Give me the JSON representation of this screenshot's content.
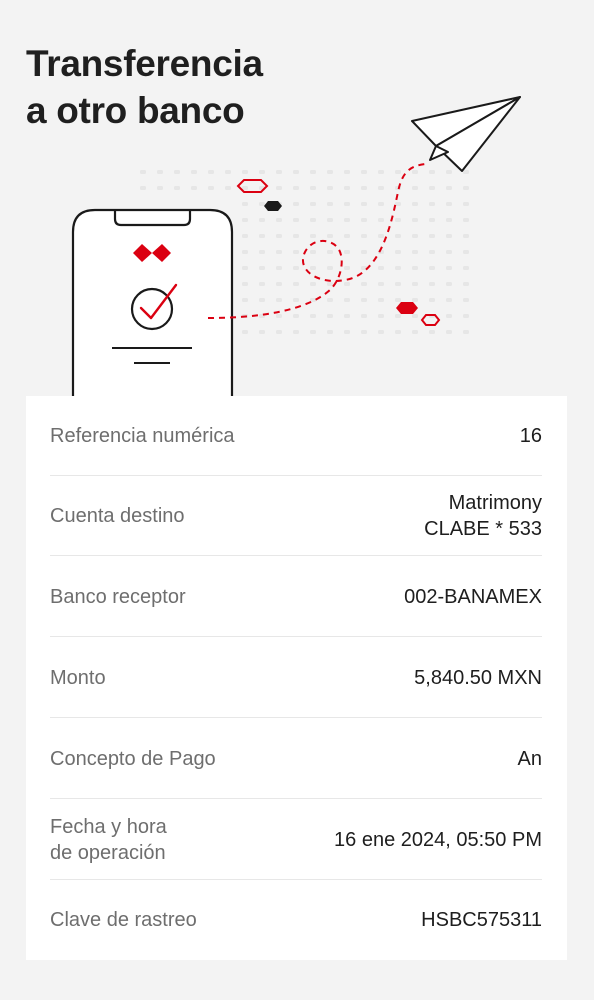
{
  "header": {
    "title_line1": "Transferencia",
    "title_line2": "a otro banco"
  },
  "illustration": {
    "description_icons": [
      "phone-icon",
      "hsbc-logo-icon",
      "check-circle-icon",
      "paper-plane-icon"
    ],
    "accent_color": "#db0011"
  },
  "details": {
    "rows": [
      {
        "label": "Referencia numérica",
        "value": "16"
      },
      {
        "label": "Cuenta destino",
        "value_line1": "Matrimony",
        "value_line2": "CLABE * 533"
      },
      {
        "label": "Banco receptor",
        "value": "002-BANAMEX"
      },
      {
        "label": "Monto",
        "value": "5,840.50 MXN"
      },
      {
        "label": "Concepto de Pago",
        "value": "An"
      },
      {
        "label": "Fecha y hora\nde operación",
        "value": "16 ene 2024, 05:50 PM"
      },
      {
        "label": "Clave de rastreo",
        "value": "HSBC575311"
      }
    ]
  }
}
